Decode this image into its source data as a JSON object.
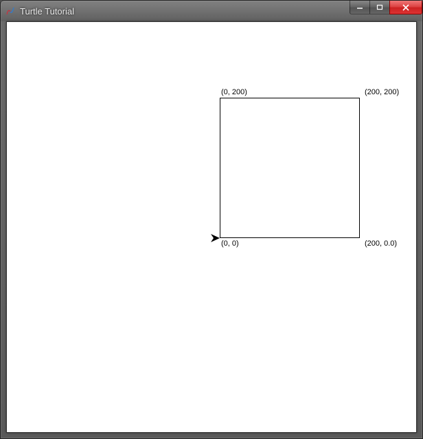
{
  "window": {
    "title": "Turtle Tutorial"
  },
  "labels": {
    "top_left": "(0, 200)",
    "top_right": "(200, 200)",
    "bottom_left": "(0, 0)",
    "bottom_right": "(200, 0.0)"
  },
  "chart_data": {
    "type": "scatter",
    "title": "",
    "xlabel": "",
    "ylabel": "",
    "xlim": [
      0,
      200
    ],
    "ylim": [
      0,
      200
    ],
    "square_vertices": [
      {
        "x": 0,
        "y": 0
      },
      {
        "x": 200,
        "y": 0
      },
      {
        "x": 200,
        "y": 200
      },
      {
        "x": 0,
        "y": 200
      }
    ],
    "turtle_position": {
      "x": 0,
      "y": 0,
      "heading": 0
    }
  }
}
